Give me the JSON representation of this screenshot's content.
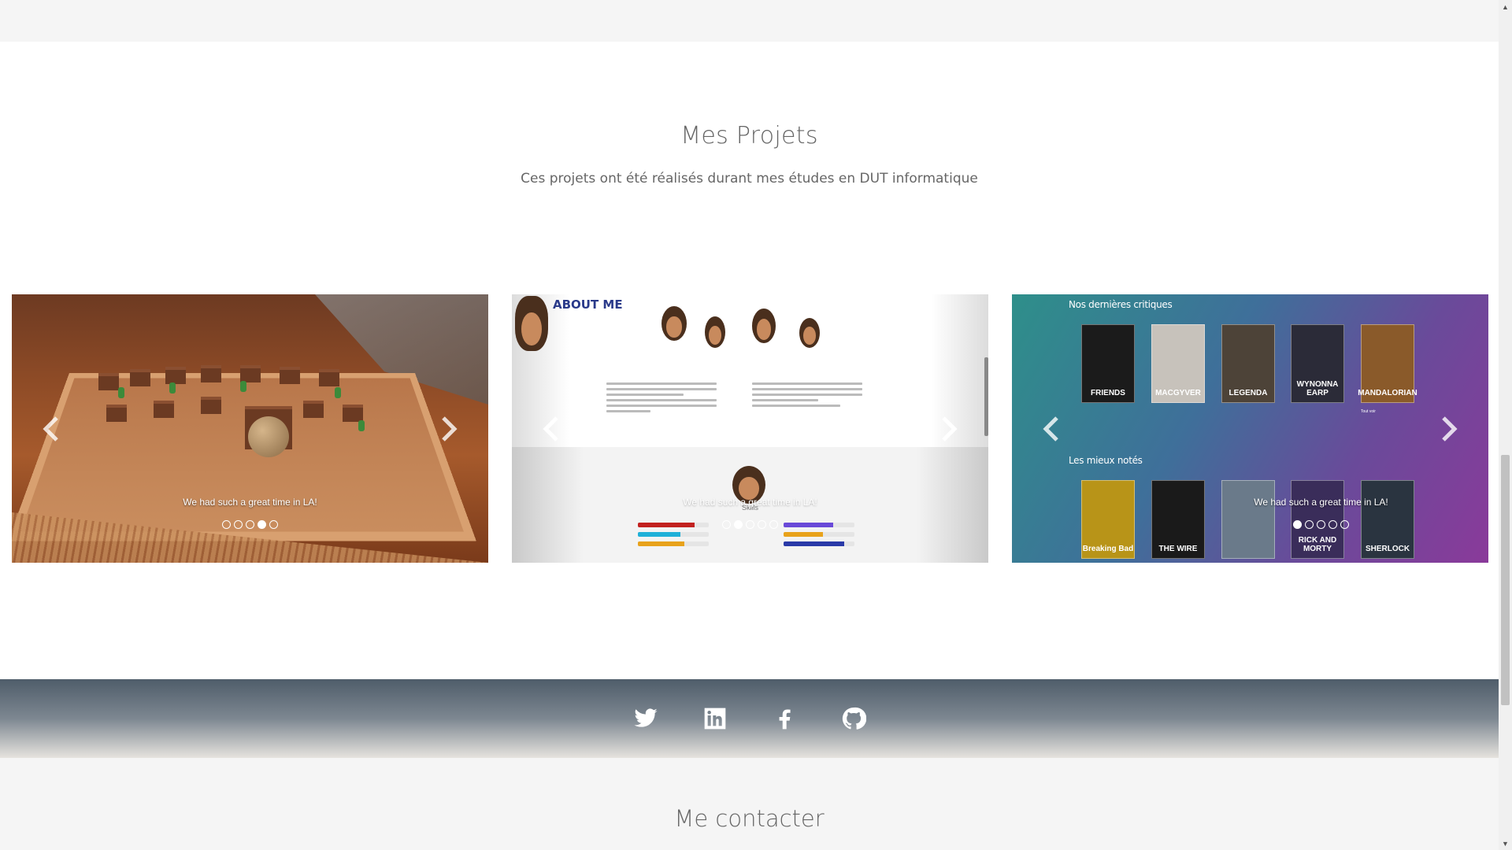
{
  "projects": {
    "title": "Mes Projets",
    "subtitle": "Ces projets ont été réalisés durant mes études en DUT informatique"
  },
  "carousels": [
    {
      "name": "game-project",
      "caption": "We had such a great time in LA!",
      "dots": 5,
      "active_dot": 4
    },
    {
      "name": "about-me-project",
      "heading": "ABOUT ME",
      "caption": "We had such a great time in LA!",
      "skills_label": "Skills",
      "dots": 5,
      "active_dot": 2
    },
    {
      "name": "movie-critics-project",
      "section_latest": "Nos dernières critiques",
      "section_best": "Les mieux notés",
      "see_all": "Tout voir",
      "caption": "We had such a great time in LA!",
      "dots": 5,
      "active_dot": 1,
      "latest_posters": [
        {
          "title": "FRIENDS",
          "color": "#1b1b1b"
        },
        {
          "title": "MACGYVER",
          "color": "#c7c2bb"
        },
        {
          "title": "LEGENDA",
          "color": "#4d4338"
        },
        {
          "title": "WYNONNA EARP",
          "color": "#2b2b38"
        },
        {
          "title": "MANDALORIAN",
          "color": "#8a5a2a"
        }
      ],
      "best_posters": [
        {
          "title": "Breaking Bad",
          "color": "#b89418"
        },
        {
          "title": "THE WIRE",
          "color": "#1a1a1a"
        },
        {
          "title": "",
          "color": "#6a7a8a"
        },
        {
          "title": "RICK AND MORTY",
          "color": "#3a2d5a"
        },
        {
          "title": "SHERLOCK",
          "color": "#2a3440"
        }
      ]
    }
  ],
  "social": [
    "twitter-icon",
    "linkedin-icon",
    "facebook-icon",
    "github-icon"
  ],
  "contact": {
    "title": "Me contacter"
  },
  "colors": {
    "page_bg": "#f5f5f5",
    "section_bg": "#ffffff",
    "footer_gradient_top": "#4f5d6a",
    "heading_text": "#666666"
  }
}
